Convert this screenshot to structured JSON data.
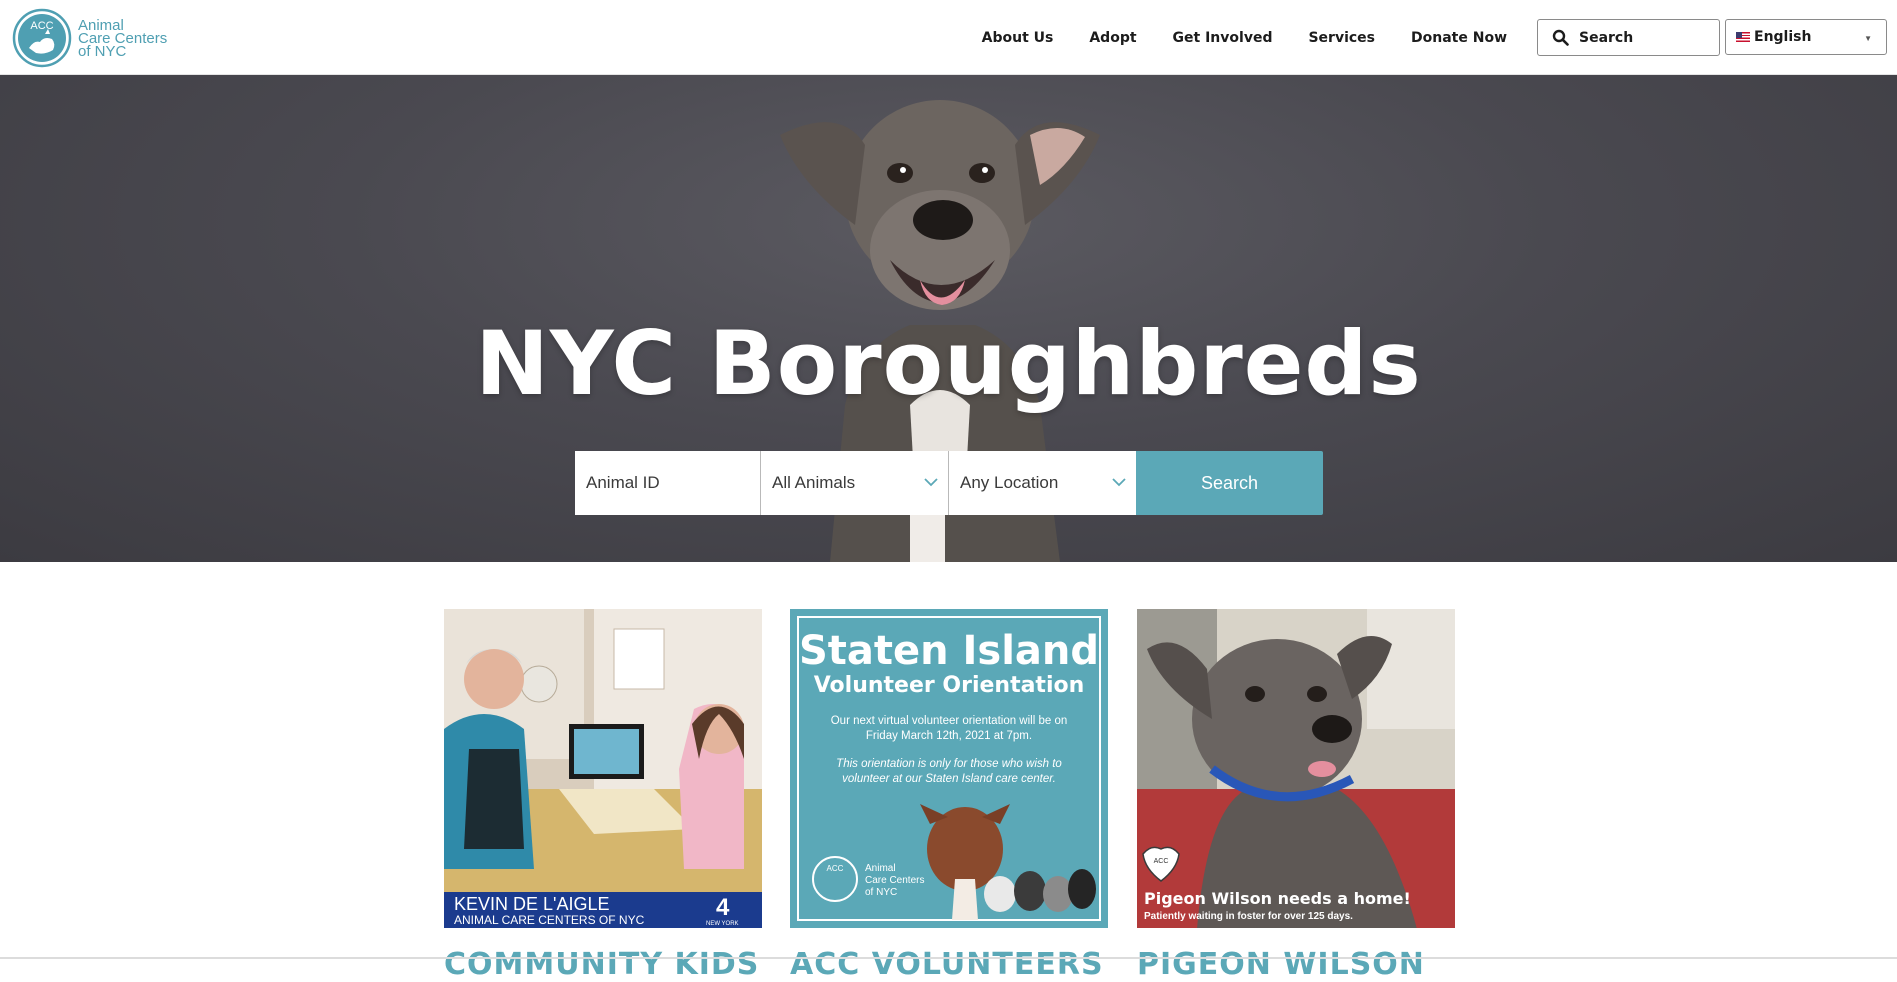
{
  "header": {
    "logo_abbr": "ACC",
    "logo_name": [
      "Animal",
      "Care Centers",
      "of NYC"
    ],
    "nav": [
      "About Us",
      "Adopt",
      "Get Involved",
      "Services",
      "Donate Now"
    ],
    "search_label": "Search",
    "language": "English"
  },
  "hero": {
    "title": "NYC Boroughbreds",
    "animal_id_placeholder": "Animal ID",
    "animal_type": "All Animals",
    "location": "Any Location",
    "search_button": "Search"
  },
  "cards": [
    {
      "title": "COMMUNITY KIDS",
      "caption_name": "KEVIN DE L'AIGLE",
      "caption_org": "ANIMAL CARE CENTERS OF NYC",
      "channel": "4",
      "channel_sub": "NEW YORK"
    },
    {
      "title": "ACC VOLUNTEERS",
      "heading_1": "Staten Island",
      "heading_2": "Volunteer Orientation",
      "line_1": "Our next virtual volunteer orientation will be on",
      "line_2": "Friday March 12th, 2021 at 7pm.",
      "note_1": "This orientation is only for those who wish to",
      "note_2": "volunteer at our Staten Island care center.",
      "logo_abbr": "ACC",
      "logo_name": [
        "Animal",
        "Care Centers",
        "of NYC"
      ]
    },
    {
      "title": "PIGEON WILSON",
      "heading": "Pigeon Wilson needs a home!",
      "subheading": "Patiently waiting in foster for over 125 days.",
      "logo_abbr": "ACC"
    }
  ],
  "colors": {
    "brand": "#5ba8b7",
    "hero_bg": "#4a4950"
  }
}
